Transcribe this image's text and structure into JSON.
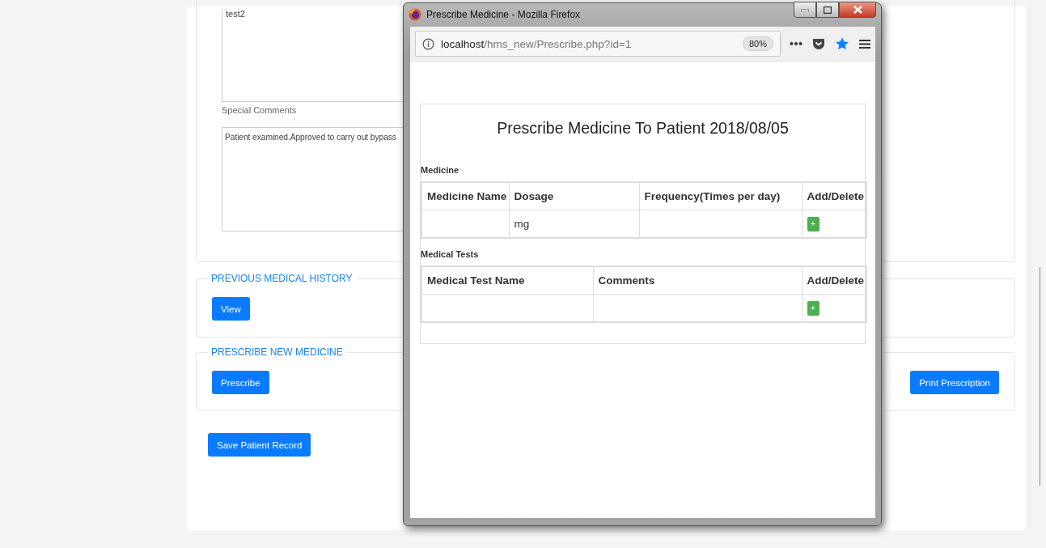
{
  "page": {
    "notes_field": {
      "value": "test2"
    },
    "special_comments": {
      "label": "Special Comments",
      "value": "Patient examined.Approved to carry out bypass"
    },
    "sections": [
      {
        "legend": "PREVIOUS MEDICAL HISTORY",
        "button": "View"
      },
      {
        "legend": "PRESCRIBE NEW MEDICINE",
        "button": "Prescribe",
        "right_button": "Print Prescription"
      }
    ],
    "save_button": "Save Patient Record"
  },
  "popup": {
    "title": "Prescribe Medicine - Mozilla Firefox",
    "url_host": "localhost",
    "url_path": "/hms_new/Prescribe.php?id=1",
    "zoom": "80%",
    "heading": "Prescribe Medicine To Patient 2018/08/05",
    "tables": [
      {
        "caption": "Medicine",
        "columns": [
          "Medicine Name",
          "Dosage",
          "Frequency(Times per day)",
          "Add/Delete"
        ],
        "rows": [
          {
            "dosage_unit": "mg",
            "add_button": "+"
          }
        ]
      },
      {
        "caption": "Medical Tests",
        "columns": [
          "Medical Test Name",
          "Comments",
          "Add/Delete"
        ],
        "rows": [
          {
            "add_button": "+"
          }
        ]
      }
    ]
  }
}
